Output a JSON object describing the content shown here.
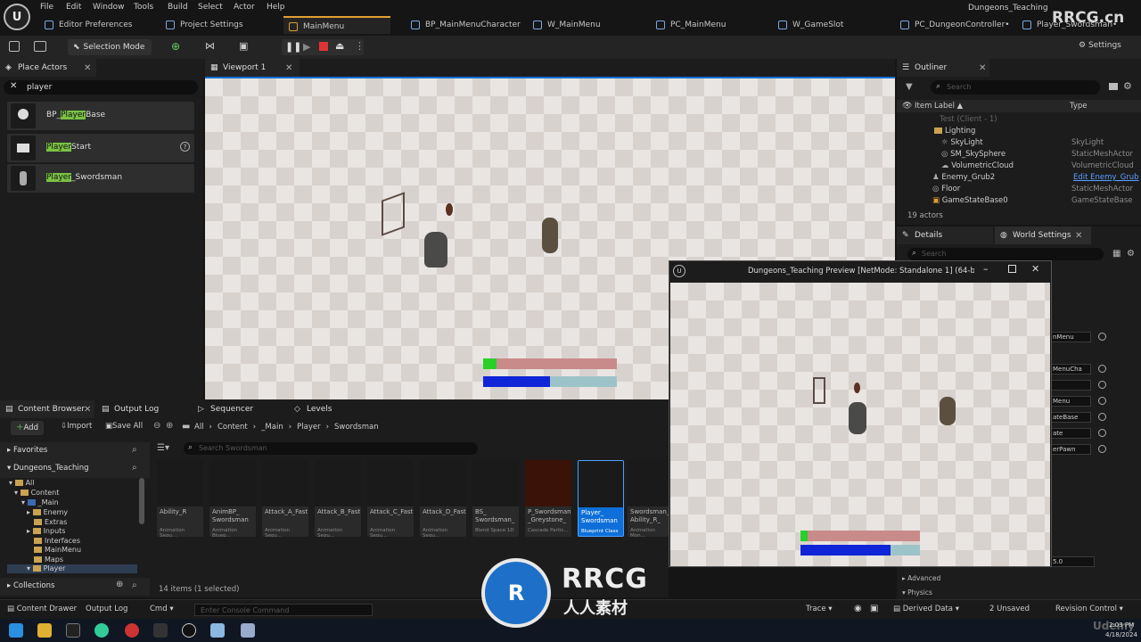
{
  "menu": [
    "File",
    "Edit",
    "Window",
    "Tools",
    "Build",
    "Select",
    "Actor",
    "Help"
  ],
  "window_title": "Dungeons_Teaching",
  "tabs": [
    "Editor Preferences",
    "Project Settings",
    "MainMenu",
    "BP_MainMenuCharacter",
    "W_MainMenu",
    "PC_MainMenu",
    "W_GameSlot",
    "PC_DungeonController•",
    "Player_Swordsman•"
  ],
  "watermark": "RRCG.cn",
  "toolbar": {
    "selection_mode": "Selection Mode",
    "settings": "Settings"
  },
  "place_actors": {
    "tab": "Place Actors",
    "search_value": "player",
    "items": [
      {
        "pre": "BP_",
        "match": "Player",
        "post": "Base"
      },
      {
        "pre": "",
        "match": "Player",
        "post": "Start"
      },
      {
        "pre": "",
        "match": "Player",
        "post": "_Swordsman"
      }
    ]
  },
  "viewport": {
    "tab": "Viewport 1",
    "health_fraction": 0.1,
    "mana_fraction": 0.5
  },
  "outliner": {
    "tab": "Outliner",
    "search_placeholder": "Search",
    "col_label": "Item Label ▲",
    "col_type": "Type",
    "rows": [
      {
        "label": "Test (Client - 1)",
        "type": ""
      },
      {
        "label": "Lighting",
        "type": ""
      },
      {
        "label": "SkyLight",
        "type": "SkyLight"
      },
      {
        "label": "SM_SkySphere",
        "type": "StaticMeshActor"
      },
      {
        "label": "VolumetricCloud",
        "type": "VolumetricCloud"
      },
      {
        "label": "Enemy_Grub2",
        "type": "Edit Enemy_Grub"
      },
      {
        "label": "Floor",
        "type": "StaticMeshActor"
      },
      {
        "label": "GameStateBase0",
        "type": "GameStateBase"
      }
    ],
    "count": "19 actors"
  },
  "details": {
    "tab_details": "Details",
    "tab_world": "World Settings",
    "search_placeholder": "Search",
    "fields": [
      "nMenu",
      "MenuCha",
      "",
      "Menu",
      "ateBase",
      "ate",
      "erPawn"
    ],
    "value": "5.0",
    "advanced": "Advanced",
    "physics": "Physics"
  },
  "preview": {
    "title": "Dungeons_Teaching Preview [NetMode: Standalone 1]  (64-bit/PC",
    "health_fraction": 0.06,
    "mana_fraction": 0.75
  },
  "content_browser": {
    "tabs": [
      "Content Browser",
      "Output Log",
      "Sequencer",
      "Levels"
    ],
    "add": "Add",
    "import": "Import",
    "save_all": "Save All",
    "breadcrumb": [
      "All",
      "Content",
      "_Main",
      "Player",
      "Swordsman"
    ],
    "search_placeholder": "Search Swordsman",
    "favorites": "Favorites",
    "project": "Dungeons_Teaching",
    "tree": [
      "All",
      "Content",
      "_Main",
      "Enemy",
      "Extras",
      "Inputs",
      "Interfaces",
      "MainMenu",
      "Maps",
      "Player"
    ],
    "collections": "Collections",
    "status": "14 items (1 selected)",
    "assets": [
      {
        "name": "Ability_R",
        "type": "Animation Sequ..."
      },
      {
        "name": "AnimBP_ Swordsman",
        "type": "Animation Bluep..."
      },
      {
        "name": "Attack_A_Fast",
        "type": "Animation Sequ..."
      },
      {
        "name": "Attack_B_Fast",
        "type": "Animation Sequ..."
      },
      {
        "name": "Attack_C_Fast",
        "type": "Animation Sequ..."
      },
      {
        "name": "Attack_D_Fast",
        "type": "Animation Sequ..."
      },
      {
        "name": "BS_ Swordsman_",
        "type": "Blend Space 1D"
      },
      {
        "name": "P_Swordsman _Greystone_",
        "type": "Cascade Partic..."
      },
      {
        "name": "Player_ Swordsman",
        "type": "Blueprint Class"
      },
      {
        "name": "Swordsman_ Ability_R_",
        "type": "Animation Mon..."
      }
    ]
  },
  "statusbar": {
    "content_drawer": "Content Drawer",
    "output_log": "Output Log",
    "cmd": "Cmd",
    "console_placeholder": "Enter Console Command",
    "trace": "Trace",
    "derived_data": "Derived Data",
    "unsaved": "2 Unsaved",
    "revision": "Revision Control"
  },
  "clock": {
    "time": "2:03 PM",
    "date": "4/18/2024"
  },
  "brand": {
    "logo_text": "RRCG",
    "logo_sub": "人人素材",
    "corner": "Udemy"
  }
}
